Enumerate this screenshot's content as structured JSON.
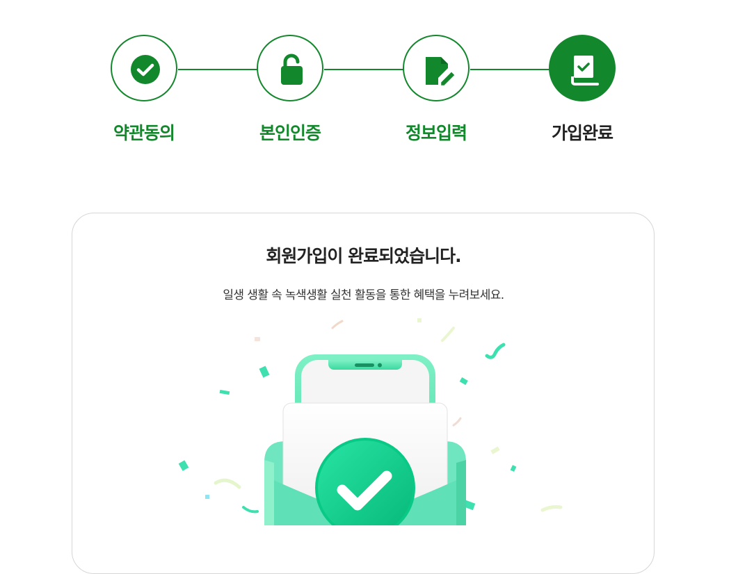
{
  "steps": [
    {
      "label": "약관동의",
      "icon": "check-circle-icon",
      "state": "done"
    },
    {
      "label": "본인인증",
      "icon": "unlock-icon",
      "state": "done"
    },
    {
      "label": "정보입력",
      "icon": "edit-document-icon",
      "state": "done"
    },
    {
      "label": "가입완료",
      "icon": "completed-book-icon",
      "state": "active"
    }
  ],
  "colors": {
    "accent": "#13872c",
    "text_dark": "#222222",
    "card_border": "#d6d6d6",
    "mint": "#2fe0a6"
  },
  "card": {
    "title": "회원가입이 완료되었습니다.",
    "subtitle": "일생 생활 속 녹색생활 실천 활동을 통한 혜택을 누려보세요.",
    "illustration": "phone-envelope-check-illustration"
  }
}
